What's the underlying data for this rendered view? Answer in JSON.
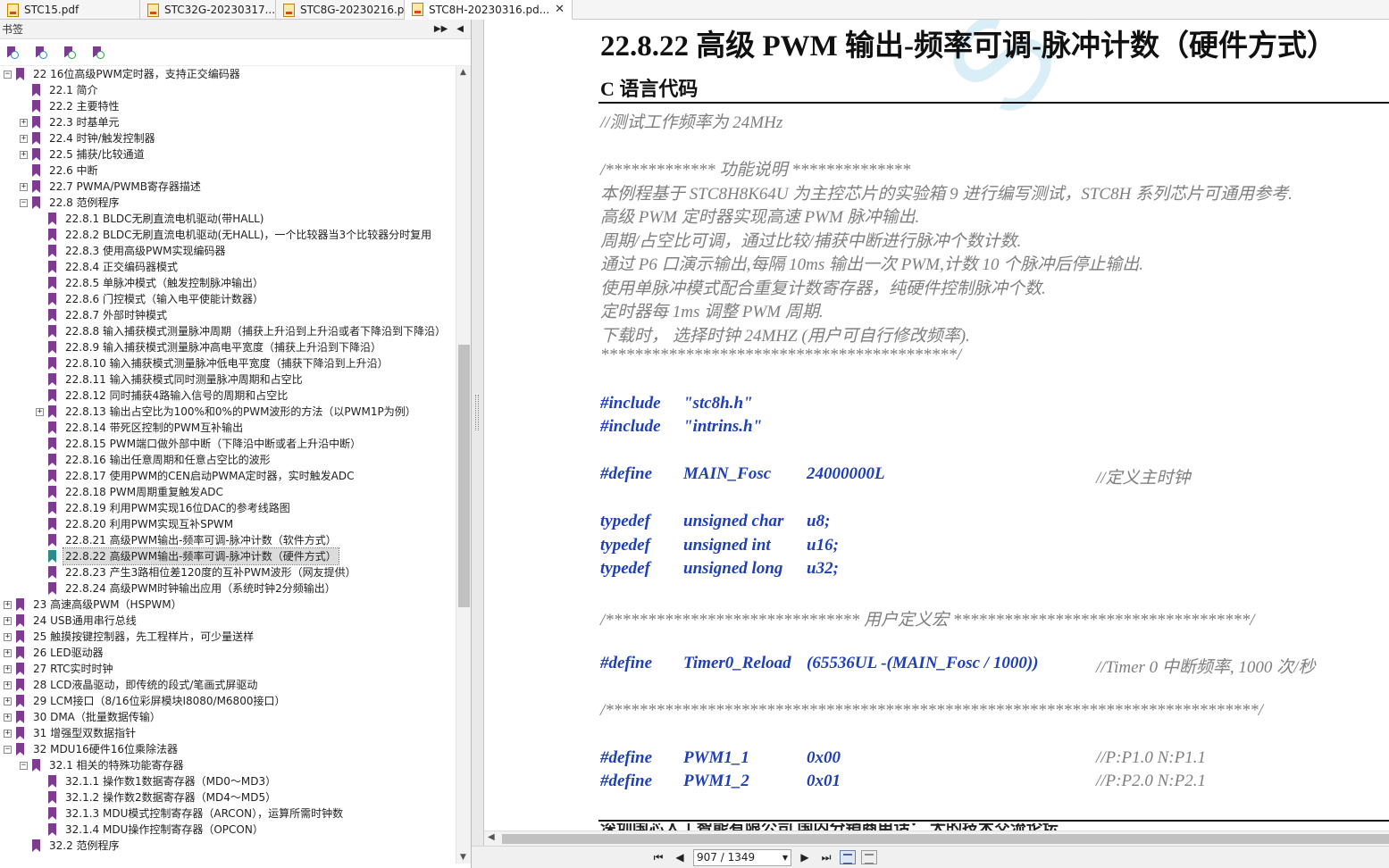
{
  "tabs": [
    {
      "title": "STC15.pdf",
      "active": false
    },
    {
      "title": "STC32G-20230317....",
      "active": false
    },
    {
      "title": "STC8G-20230216.p...",
      "active": false
    },
    {
      "title": "STC8H-20230316.pd...",
      "active": true
    }
  ],
  "tab_close_glyph": "✕",
  "bookmarks": {
    "header": "书签",
    "tree": [
      {
        "label": "22 16位高级PWM定时器，支持正交编码器",
        "level": 0,
        "expander": "minus"
      },
      {
        "label": "22.1 简介",
        "level": 1,
        "expander": "none"
      },
      {
        "label": "22.2 主要特性",
        "level": 1,
        "expander": "none"
      },
      {
        "label": "22.3 时基单元",
        "level": 1,
        "expander": "plus"
      },
      {
        "label": "22.4 时钟/触发控制器",
        "level": 1,
        "expander": "plus"
      },
      {
        "label": "22.5 捕获/比较通道",
        "level": 1,
        "expander": "plus"
      },
      {
        "label": "22.6 中断",
        "level": 1,
        "expander": "none"
      },
      {
        "label": "22.7 PWMA/PWMB寄存器描述",
        "level": 1,
        "expander": "plus"
      },
      {
        "label": "22.8 范例程序",
        "level": 1,
        "expander": "minus"
      },
      {
        "label": "22.8.1 BLDC无刷直流电机驱动(带HALL)",
        "level": 2,
        "expander": "none"
      },
      {
        "label": "22.8.2 BLDC无刷直流电机驱动(无HALL)，一个比较器当3个比较器分时复用",
        "level": 2,
        "expander": "none"
      },
      {
        "label": "22.8.3 使用高级PWM实现编码器",
        "level": 2,
        "expander": "none"
      },
      {
        "label": "22.8.4 正交编码器模式",
        "level": 2,
        "expander": "none"
      },
      {
        "label": "22.8.5 单脉冲模式（触发控制脉冲输出）",
        "level": 2,
        "expander": "none"
      },
      {
        "label": "22.8.6 门控模式（输入电平使能计数器）",
        "level": 2,
        "expander": "none"
      },
      {
        "label": "22.8.7 外部时钟模式",
        "level": 2,
        "expander": "none"
      },
      {
        "label": "22.8.8 输入捕获模式测量脉冲周期（捕获上升沿到上升沿或者下降沿到下降沿）",
        "level": 2,
        "expander": "none"
      },
      {
        "label": "22.8.9 输入捕获模式测量脉冲高电平宽度（捕获上升沿到下降沿）",
        "level": 2,
        "expander": "none"
      },
      {
        "label": "22.8.10 输入捕获模式测量脉冲低电平宽度（捕获下降沿到上升沿）",
        "level": 2,
        "expander": "none"
      },
      {
        "label": "22.8.11 输入捕获模式同时测量脉冲周期和占空比",
        "level": 2,
        "expander": "none"
      },
      {
        "label": "22.8.12 同时捕获4路输入信号的周期和占空比",
        "level": 2,
        "expander": "none"
      },
      {
        "label": "22.8.13 输出占空比为100%和0%的PWM波形的方法（以PWM1P为例）",
        "level": 2,
        "expander": "plus"
      },
      {
        "label": "22.8.14 带死区控制的PWM互补输出",
        "level": 2,
        "expander": "none"
      },
      {
        "label": "22.8.15 PWM端口做外部中断（下降沿中断或者上升沿中断）",
        "level": 2,
        "expander": "none"
      },
      {
        "label": "22.8.16 输出任意周期和任意占空比的波形",
        "level": 2,
        "expander": "none"
      },
      {
        "label": "22.8.17 使用PWM的CEN启动PWMA定时器，实时触发ADC",
        "level": 2,
        "expander": "none"
      },
      {
        "label": "22.8.18 PWM周期重复触发ADC",
        "level": 2,
        "expander": "none"
      },
      {
        "label": "22.8.19 利用PWM实现16位DAC的参考线路图",
        "level": 2,
        "expander": "none"
      },
      {
        "label": "22.8.20 利用PWM实现互补SPWM",
        "level": 2,
        "expander": "none"
      },
      {
        "label": "22.8.21 高级PWM输出-频率可调-脉冲计数（软件方式）",
        "level": 2,
        "expander": "none"
      },
      {
        "label": "22.8.22 高级PWM输出-频率可调-脉冲计数（硬件方式）",
        "level": 2,
        "expander": "none",
        "selected": true
      },
      {
        "label": "22.8.23 产生3路相位差120度的互补PWM波形（网友提供）",
        "level": 2,
        "expander": "none"
      },
      {
        "label": "22.8.24 高级PWM时钟输出应用（系统时钟2分频输出）",
        "level": 2,
        "expander": "none"
      },
      {
        "label": "23 高速高级PWM（HSPWM）",
        "level": 0,
        "expander": "plus"
      },
      {
        "label": "24 USB通用串行总线",
        "level": 0,
        "expander": "plus"
      },
      {
        "label": "25 触摸按键控制器，先工程样片，可少量送样",
        "level": 0,
        "expander": "plus"
      },
      {
        "label": "26 LED驱动器",
        "level": 0,
        "expander": "plus"
      },
      {
        "label": "27 RTC实时时钟",
        "level": 0,
        "expander": "plus"
      },
      {
        "label": "28 LCD液晶驱动，即传统的段式/笔画式屏驱动",
        "level": 0,
        "expander": "plus"
      },
      {
        "label": "29 LCM接口（8/16位彩屏模块I8080/M6800接口）",
        "level": 0,
        "expander": "plus"
      },
      {
        "label": "30 DMA（批量数据传输）",
        "level": 0,
        "expander": "plus"
      },
      {
        "label": "31 增强型双数据指针",
        "level": 0,
        "expander": "plus"
      },
      {
        "label": "32 MDU16硬件16位乘除法器",
        "level": 0,
        "expander": "minus"
      },
      {
        "label": "32.1 相关的特殊功能寄存器",
        "level": 1,
        "expander": "minus"
      },
      {
        "label": "32.1.1 操作数1数据寄存器（MD0～MD3）",
        "level": 2,
        "expander": "none"
      },
      {
        "label": "32.1.2 操作数2数据寄存器（MD4～MD5）",
        "level": 2,
        "expander": "none"
      },
      {
        "label": "32.1.3 MDU模式控制寄存器（ARCON），运算所需时钟数",
        "level": 2,
        "expander": "none"
      },
      {
        "label": "32.1.4 MDU操作控制寄存器（OPCON）",
        "level": 2,
        "expander": "none"
      },
      {
        "label": "32.2 范例程序",
        "level": 1,
        "expander": "none"
      }
    ]
  },
  "document": {
    "watermark": "STC MC",
    "heading": "22.8.22   高级 PWM 输出-频率可调-脉冲计数（硬件方式）",
    "subheading": "C 语言代码",
    "comment_freq": "//测试工作频率为 24MHz",
    "func_header": "/************* 功能说明  **************",
    "desc": [
      "本例程基于 STC8H8K64U 为主控芯片的实验箱 9 进行编写测试，STC8H 系列芯片可通用参考.",
      "高级 PWM 定时器实现高速 PWM 脉冲输出.",
      "周期/占空比可调，通过比较/捕获中断进行脉冲个数计数.",
      "通过 P6 口演示输出,每隔 10ms 输出一次 PWM,计数 10 个脉冲后停止输出.",
      "使用单脉冲模式配合重复计数寄存器，纯硬件控制脉冲个数.",
      "定时器每 1ms 调整 PWM 周期.",
      "下载时，   选择时钟 24MHZ (用户可自行修改频率)."
    ],
    "func_footer": "******************************************/",
    "includes": [
      {
        "kw": "#include",
        "val": "\"stc8h.h\""
      },
      {
        "kw": "#include",
        "val": "\"intrins.h\""
      }
    ],
    "define_main": {
      "kw": "#define",
      "name": "MAIN_Fosc",
      "val": "24000000L",
      "comment": "//定义主时钟"
    },
    "typedefs": [
      {
        "kw": "typedef",
        "type": "unsigned char",
        "name": "u8;"
      },
      {
        "kw": "typedef",
        "type": "unsigned int",
        "name": "u16;"
      },
      {
        "kw": "typedef",
        "type": "unsigned long",
        "name": "u32;"
      }
    ],
    "user_macro_line": "/****************************** 用户定义宏 ***********************************/",
    "define_timer": {
      "kw": "#define",
      "name": "Timer0_Reload",
      "val": "(65536UL -(MAIN_Fosc / 1000))",
      "comment": "//Timer 0  中断频率, 1000 次/秒"
    },
    "separator_line": "/*****************************************************************************/",
    "pwm_defines": [
      {
        "kw": "#define",
        "name": "PWM1_1",
        "val": "0x00",
        "comment": "//P:P1.0    N:P1.1"
      },
      {
        "kw": "#define",
        "name": "PWM1_2",
        "val": "0x01",
        "comment": "//P:P2.0    N:P2.1"
      }
    ],
    "footer_cut": "深圳国芯人工智能有限公司     国内分销商电话：                                       大的技术交流论坛"
  },
  "statusbar": {
    "first": "⏮",
    "prev": "◀",
    "page_value": "907 / 1349",
    "next": "▶",
    "last": "⏭"
  },
  "colors": {
    "code_keyword": "#1f3fb5",
    "code_comment": "#7f7f7f",
    "bookmark": "#7d3c8f",
    "bookmark_current": "#2e8b8b"
  }
}
